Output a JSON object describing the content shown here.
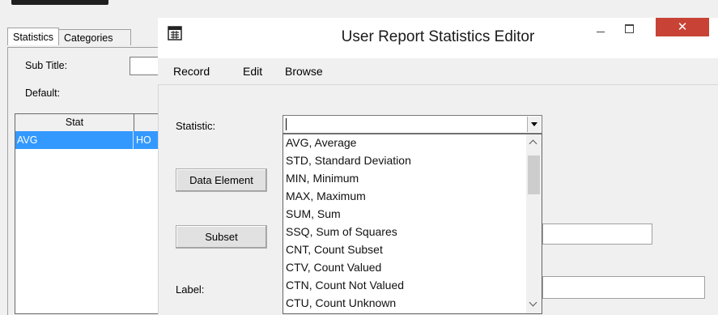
{
  "background_window": {
    "tabs": [
      "Statistics",
      "Categories"
    ],
    "sub_title_label": "Sub Title:",
    "default_label": "Default:",
    "grid": {
      "columns": [
        "Stat",
        ""
      ],
      "rows": [
        [
          "AVG",
          "HO"
        ]
      ]
    }
  },
  "dialog": {
    "title": "User Report Statistics Editor",
    "close_glyph": "✕",
    "menu": [
      "Record",
      "Edit",
      "Browse"
    ],
    "statistic_label": "Statistic:",
    "statistic_value": "",
    "data_element_button": "Data Element",
    "subset_button": "Subset",
    "label_label": "Label:",
    "dropdown_options": [
      "AVG, Average",
      "STD, Standard Deviation",
      "MIN, Minimum",
      "MAX, Maximum",
      "SUM, Sum",
      "SSQ, Sum of Squares",
      "CNT, Count Subset",
      "CTV, Count Valued",
      "CTN, Count Not Valued",
      "CTU, Count Unknown"
    ]
  },
  "colors": {
    "selection": "#3399ff",
    "close_button": "#c84335",
    "window_bg": "#f0f0f0"
  },
  "icons": [
    "app-window-icon",
    "minimize-icon",
    "maximize-icon",
    "close-icon",
    "chevron-up-icon",
    "chevron-down-icon",
    "dropdown-arrow-icon"
  ]
}
